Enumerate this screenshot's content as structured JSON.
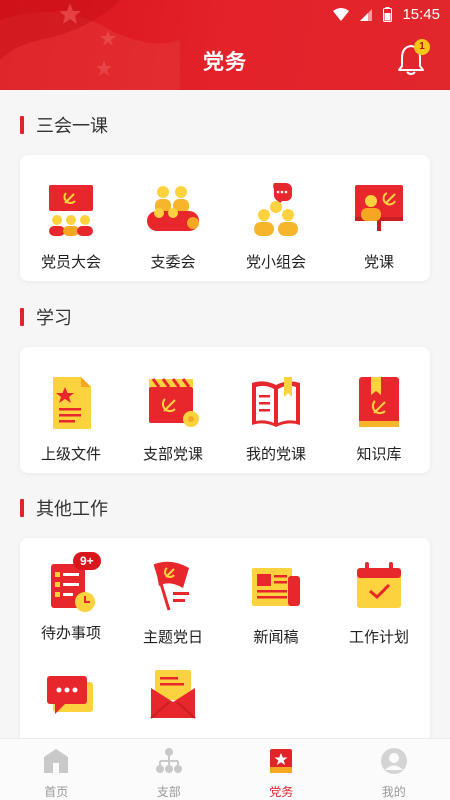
{
  "status_bar": {
    "time": "15:45"
  },
  "header": {
    "title": "党务",
    "notification_count": "1"
  },
  "sections": [
    {
      "title": "三会一课",
      "items": [
        {
          "label": "党员大会",
          "icon": "party-meeting-icon"
        },
        {
          "label": "支委会",
          "icon": "branch-committee-icon"
        },
        {
          "label": "党小组会",
          "icon": "party-group-meeting-icon"
        },
        {
          "label": "党课",
          "icon": "party-lecture-icon"
        }
      ]
    },
    {
      "title": "学习",
      "items": [
        {
          "label": "上级文件",
          "icon": "document-icon"
        },
        {
          "label": "支部党课",
          "icon": "video-lesson-icon"
        },
        {
          "label": "我的党课",
          "icon": "open-book-icon"
        },
        {
          "label": "知识库",
          "icon": "knowledge-book-icon"
        }
      ]
    },
    {
      "title": "其他工作",
      "items": [
        {
          "label": "待办事项",
          "icon": "todo-checklist-icon",
          "badge": "9+"
        },
        {
          "label": "主题党日",
          "icon": "party-flag-icon"
        },
        {
          "label": "新闻稿",
          "icon": "newspaper-icon"
        },
        {
          "label": "工作计划",
          "icon": "calendar-plan-icon"
        },
        {
          "label": "",
          "icon": "chat-message-icon"
        },
        {
          "label": "",
          "icon": "mail-envelope-icon"
        }
      ]
    }
  ],
  "tabbar": [
    {
      "label": "首页",
      "icon": "home-icon",
      "active": false
    },
    {
      "label": "支部",
      "icon": "org-chart-icon",
      "active": false
    },
    {
      "label": "党务",
      "icon": "party-affairs-icon",
      "active": true
    },
    {
      "label": "我的",
      "icon": "user-icon",
      "active": false
    }
  ],
  "colors": {
    "primary": "#e0242a",
    "accent_yellow": "#f5c518",
    "text": "#222222",
    "muted": "#999999"
  }
}
